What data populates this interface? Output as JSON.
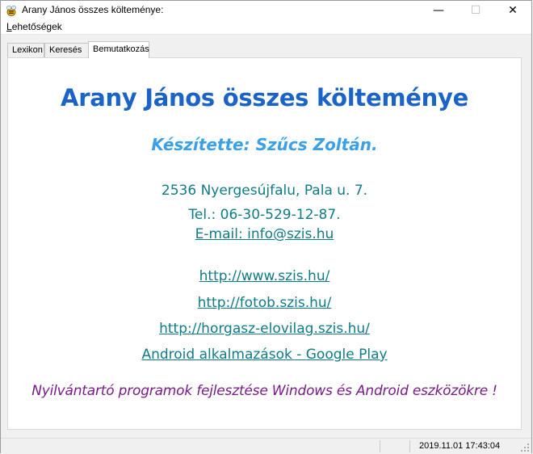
{
  "window": {
    "title": "Arany János összes költeménye:",
    "controls": {
      "minimize": "—",
      "maximize": "☐",
      "close": "✕"
    }
  },
  "menu": {
    "options_label_first": "L",
    "options_label_rest": "ehetőségek"
  },
  "tabs": [
    {
      "label": "Lexikon"
    },
    {
      "label": "Keresés"
    },
    {
      "label": "Bemutatkozás"
    }
  ],
  "about": {
    "heading": "Arany János összes költeménye",
    "author": "Készítette: Szűcs Zoltán.",
    "address": "2536 Nyergesújfalu, Pala u. 7.",
    "phone": "Tel.: 06-30-529-12-87.",
    "email": "E-mail: info@szis.hu",
    "links": [
      "http://www.szis.hu/",
      "http://fotob.szis.hu/",
      "http://horgasz-elovilag.szis.hu/",
      "Android alkalmazások - Google Play "
    ],
    "tagline": "Nyilvántartó programok fejlesztése Windows és Android eszközökre !"
  },
  "status": {
    "datetime": "2019.11.01 17:43:04"
  },
  "colors": {
    "heading": "#1a63c8",
    "author": "#3aa0e8",
    "contact": "#0f7b86",
    "tagline": "#7a1a8a"
  }
}
